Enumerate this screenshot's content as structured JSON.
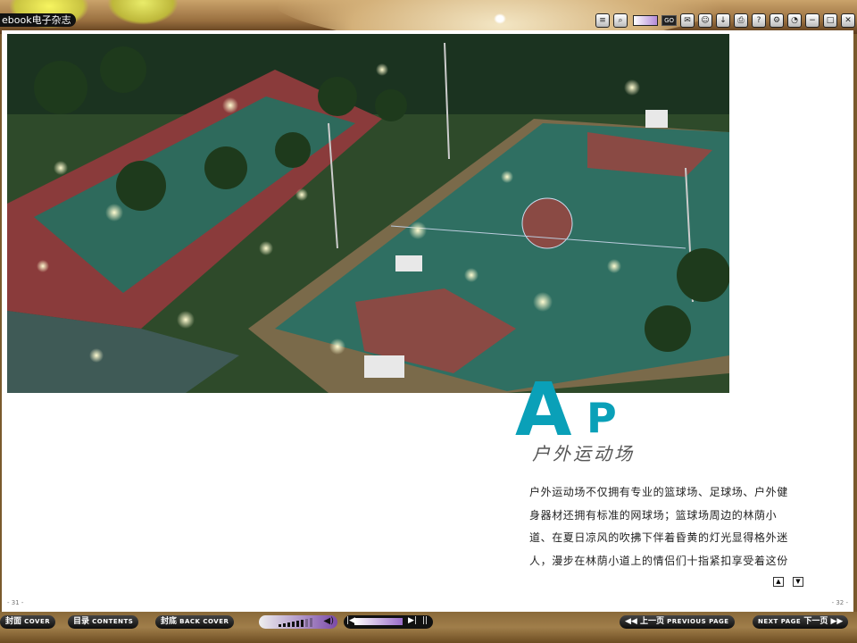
{
  "app": {
    "title": "ebook电子杂志"
  },
  "toolbar": {
    "go_label": "GO",
    "icons": [
      "list-icon",
      "search-icon",
      "page-input",
      "chat-icon",
      "person-icon",
      "download-icon",
      "print-icon",
      "help-icon",
      "settings-icon",
      "clock-icon",
      "minimize-icon",
      "maximize-icon",
      "close-icon"
    ]
  },
  "article": {
    "logo_a": "A",
    "logo_p": "P",
    "title": "户外运动场",
    "lines": [
      "户外运动场不仅拥有专业的篮球场、足球场、户外健",
      "身器材还拥有标准的网球场；篮球场周边的林荫小",
      "道、在夏日凉风的吹拂下伴着昏黄的灯光显得格外迷",
      "人，漫步在林荫小道上的情侣们十指紧扣享受着这份"
    ]
  },
  "pages": {
    "left": "- 31 -",
    "right": "- 32 -"
  },
  "bottom": {
    "cover_cn": "封面",
    "cover_en": "COVER",
    "contents_cn": "目录",
    "contents_en": "CONTENTS",
    "back_cn": "封底",
    "back_en": "BACK COVER",
    "prev_cn": "上一页",
    "prev_en": "PREVIOUS PAGE",
    "next_en": "NEXT PAGE",
    "next_cn": "下一页",
    "volume_level": 0.75
  },
  "colors": {
    "accent": "#0aa0b8",
    "court": "#2f6f62",
    "bar": "#111111"
  }
}
